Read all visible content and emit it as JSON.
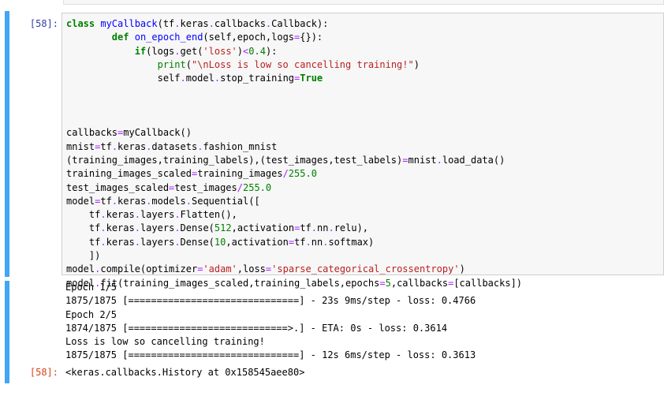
{
  "input_cell": {
    "prompt": "[58]:",
    "code_lines": [
      [
        {
          "t": "class",
          "c": "kw"
        },
        {
          "t": " "
        },
        {
          "t": "myCallback",
          "c": "nm"
        },
        {
          "t": "(tf"
        },
        {
          "t": ".",
          "c": "op"
        },
        {
          "t": "keras"
        },
        {
          "t": ".",
          "c": "op"
        },
        {
          "t": "callbacks"
        },
        {
          "t": ".",
          "c": "op"
        },
        {
          "t": "Callback):"
        }
      ],
      [
        {
          "t": "        "
        },
        {
          "t": "def",
          "c": "kw"
        },
        {
          "t": " "
        },
        {
          "t": "on_epoch_end",
          "c": "nm"
        },
        {
          "t": "(self,epoch,logs"
        },
        {
          "t": "=",
          "c": "op"
        },
        {
          "t": "{}):"
        }
      ],
      [
        {
          "t": "            "
        },
        {
          "t": "if",
          "c": "kw"
        },
        {
          "t": "(logs"
        },
        {
          "t": ".",
          "c": "op"
        },
        {
          "t": "get("
        },
        {
          "t": "'loss'",
          "c": "str"
        },
        {
          "t": ")"
        },
        {
          "t": "<",
          "c": "op"
        },
        {
          "t": "0.4",
          "c": "num"
        },
        {
          "t": "):"
        }
      ],
      [
        {
          "t": "                "
        },
        {
          "t": "print",
          "c": "bi"
        },
        {
          "t": "("
        },
        {
          "t": "\"\\nLoss is low so cancelling training!\"",
          "c": "str"
        },
        {
          "t": ")"
        }
      ],
      [
        {
          "t": "                self"
        },
        {
          "t": ".",
          "c": "op"
        },
        {
          "t": "model"
        },
        {
          "t": ".",
          "c": "op"
        },
        {
          "t": "stop_training"
        },
        {
          "t": "=",
          "c": "op"
        },
        {
          "t": "True",
          "c": "kw"
        }
      ],
      [],
      [],
      [],
      [
        {
          "t": "callbacks"
        },
        {
          "t": "=",
          "c": "op"
        },
        {
          "t": "myCallback()"
        }
      ],
      [
        {
          "t": "mnist"
        },
        {
          "t": "=",
          "c": "op"
        },
        {
          "t": "tf"
        },
        {
          "t": ".",
          "c": "op"
        },
        {
          "t": "keras"
        },
        {
          "t": ".",
          "c": "op"
        },
        {
          "t": "datasets"
        },
        {
          "t": ".",
          "c": "op"
        },
        {
          "t": "fashion_mnist"
        }
      ],
      [
        {
          "t": "(training_images,training_labels),(test_images,test_labels)"
        },
        {
          "t": "=",
          "c": "op"
        },
        {
          "t": "mnist"
        },
        {
          "t": ".",
          "c": "op"
        },
        {
          "t": "load_data()"
        }
      ],
      [
        {
          "t": "training_images_scaled"
        },
        {
          "t": "=",
          "c": "op"
        },
        {
          "t": "training_images"
        },
        {
          "t": "/",
          "c": "op"
        },
        {
          "t": "255.0",
          "c": "num"
        }
      ],
      [
        {
          "t": "test_images_scaled"
        },
        {
          "t": "=",
          "c": "op"
        },
        {
          "t": "test_images"
        },
        {
          "t": "/",
          "c": "op"
        },
        {
          "t": "255.0",
          "c": "num"
        }
      ],
      [
        {
          "t": "model"
        },
        {
          "t": "=",
          "c": "op"
        },
        {
          "t": "tf"
        },
        {
          "t": ".",
          "c": "op"
        },
        {
          "t": "keras"
        },
        {
          "t": ".",
          "c": "op"
        },
        {
          "t": "models"
        },
        {
          "t": ".",
          "c": "op"
        },
        {
          "t": "Sequential(["
        }
      ],
      [
        {
          "t": "    tf"
        },
        {
          "t": ".",
          "c": "op"
        },
        {
          "t": "keras"
        },
        {
          "t": ".",
          "c": "op"
        },
        {
          "t": "layers"
        },
        {
          "t": ".",
          "c": "op"
        },
        {
          "t": "Flatten(),"
        }
      ],
      [
        {
          "t": "    tf"
        },
        {
          "t": ".",
          "c": "op"
        },
        {
          "t": "keras"
        },
        {
          "t": ".",
          "c": "op"
        },
        {
          "t": "layers"
        },
        {
          "t": ".",
          "c": "op"
        },
        {
          "t": "Dense("
        },
        {
          "t": "512",
          "c": "num"
        },
        {
          "t": ",activation"
        },
        {
          "t": "=",
          "c": "op"
        },
        {
          "t": "tf"
        },
        {
          "t": ".",
          "c": "op"
        },
        {
          "t": "nn"
        },
        {
          "t": ".",
          "c": "op"
        },
        {
          "t": "relu),"
        }
      ],
      [
        {
          "t": "    tf"
        },
        {
          "t": ".",
          "c": "op"
        },
        {
          "t": "keras"
        },
        {
          "t": ".",
          "c": "op"
        },
        {
          "t": "layers"
        },
        {
          "t": ".",
          "c": "op"
        },
        {
          "t": "Dense("
        },
        {
          "t": "10",
          "c": "num"
        },
        {
          "t": ",activation"
        },
        {
          "t": "=",
          "c": "op"
        },
        {
          "t": "tf"
        },
        {
          "t": ".",
          "c": "op"
        },
        {
          "t": "nn"
        },
        {
          "t": ".",
          "c": "op"
        },
        {
          "t": "softmax)"
        }
      ],
      [
        {
          "t": "    ])"
        }
      ],
      [
        {
          "t": "model"
        },
        {
          "t": ".",
          "c": "op"
        },
        {
          "t": "compile(optimizer"
        },
        {
          "t": "=",
          "c": "op"
        },
        {
          "t": "'adam'",
          "c": "str"
        },
        {
          "t": ",loss"
        },
        {
          "t": "=",
          "c": "op"
        },
        {
          "t": "'sparse_categorical_crossentropy'",
          "c": "str"
        },
        {
          "t": ")"
        }
      ],
      [
        {
          "t": "model"
        },
        {
          "t": ".",
          "c": "op"
        },
        {
          "t": "fit(training_images_scaled,training_labels,epochs"
        },
        {
          "t": "=",
          "c": "op"
        },
        {
          "t": "5",
          "c": "num"
        },
        {
          "t": ",callbacks"
        },
        {
          "t": "=",
          "c": "op"
        },
        {
          "t": "[callbacks])"
        }
      ]
    ]
  },
  "output_cell": {
    "prompt": "[58]:",
    "stream_lines": [
      "Epoch 1/5",
      "1875/1875 [==============================] - 23s 9ms/step - loss: 0.4766",
      "Epoch 2/5",
      "1874/1875 [============================>.] - ETA: 0s - loss: 0.3614",
      "Loss is low so cancelling training!",
      "1875/1875 [==============================] - 12s 6ms/step - loss: 0.3613"
    ],
    "result": "<keras.callbacks.History at 0x158545aee80>"
  },
  "colors": {
    "cell_bar": "#42a5f5",
    "in_prompt": "#303f9f",
    "out_prompt": "#d84315",
    "keyword": "#008000",
    "name": "#0000ff",
    "string": "#ba2121",
    "operator": "#aa22ff"
  }
}
